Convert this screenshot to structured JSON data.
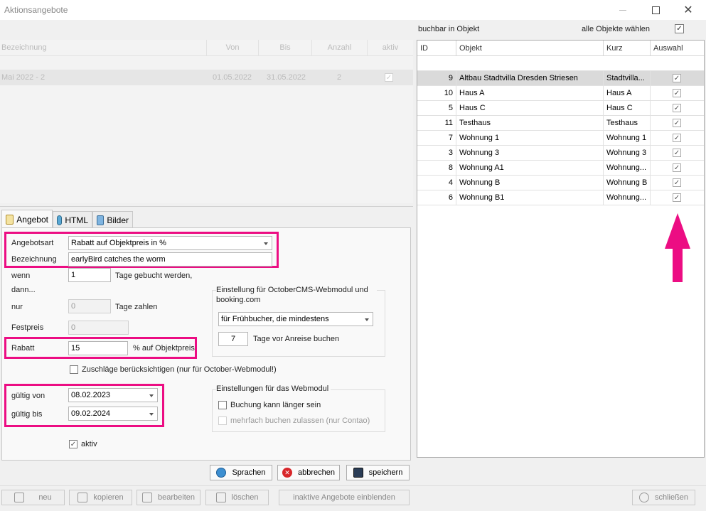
{
  "window": {
    "title": "Aktionsangebote"
  },
  "left_grid": {
    "headers": [
      "Bezeichnung",
      "Von",
      "Bis",
      "Anzahl",
      "aktiv"
    ],
    "row": {
      "bezeichnung": "Mai 2022 - 2",
      "von": "01.05.2022",
      "bis": "31.05.2022",
      "anzahl": "2",
      "aktiv": "✓"
    }
  },
  "tabs": [
    {
      "label": "Angebot",
      "icon": "angebot-icon"
    },
    {
      "label": "HTML",
      "icon": "html-icon"
    },
    {
      "label": "Bilder",
      "icon": "bilder-icon"
    }
  ],
  "form": {
    "angebotsart_label": "Angebotsart",
    "angebotsart_value": "Rabatt auf Objektpreis in %",
    "bezeichnung_label": "Bezeichnung",
    "bezeichnung_value": "earlyBird catches the worm",
    "wenn_label": "wenn",
    "wenn_value": "1",
    "wenn_suffix": "Tage gebucht werden,",
    "dann_label": "dann...",
    "nur_label": "nur",
    "nur_value": "0",
    "nur_suffix": "Tage zahlen",
    "festpreis_label": "Festpreis",
    "festpreis_value": "0",
    "rabatt_label": "Rabatt",
    "rabatt_value": "15",
    "rabatt_suffix": "% auf Objektpreis",
    "zuschlaege_label": "Zuschläge berücksichtigen (nur für October-Webmodul!)",
    "gueltig_von_label": "gültig von",
    "gueltig_von_value": "08.02.2023",
    "gueltig_bis_label": "gültig bis",
    "gueltig_bis_value": "09.02.2024",
    "aktiv_label": "aktiv",
    "aktiv_check": "✓"
  },
  "october_group": {
    "title": "Einstellung für OctoberCMS-Webmodul und booking.com",
    "select_value": "für Frühbucher, die mindestens",
    "days_value": "7",
    "days_suffix": "Tage vor Anreise buchen"
  },
  "webmodul_group": {
    "title": "Einstellungen für das Webmodul",
    "longer_label": "Buchung kann länger sein",
    "multi_label": "mehrfach buchen zulassen (nur Contao)"
  },
  "action_buttons": {
    "sprachen": "Sprachen",
    "abbrechen": "abbrechen",
    "speichern": "speichern"
  },
  "bottom_buttons": {
    "neu": "neu",
    "kopieren": "kopieren",
    "bearbeiten": "bearbeiten",
    "loeschen": "löschen",
    "inaktive": "inaktive Angebote einblenden",
    "schliessen": "schließen"
  },
  "right": {
    "buchbar_label": "buchbar in Objekt",
    "alle_label": "alle Objekte wählen",
    "alle_check": "✓",
    "headers": [
      "ID",
      "Objekt",
      "Kurz",
      "Auswahl"
    ],
    "rows": [
      {
        "id": "9",
        "objekt": "Altbau Stadtvilla Dresden Striesen",
        "kurz": "Stadtvilla...",
        "check": "✓"
      },
      {
        "id": "10",
        "objekt": "Haus A",
        "kurz": "Haus A",
        "check": "✓"
      },
      {
        "id": "5",
        "objekt": "Haus C",
        "kurz": "Haus C",
        "check": "✓"
      },
      {
        "id": "11",
        "objekt": "Testhaus",
        "kurz": "Testhaus",
        "check": "✓"
      },
      {
        "id": "7",
        "objekt": "Wohnung 1",
        "kurz": "Wohnung 1",
        "check": "✓"
      },
      {
        "id": "3",
        "objekt": "Wohnung 3",
        "kurz": "Wohnung 3",
        "check": "✓"
      },
      {
        "id": "8",
        "objekt": "Wohnung A1",
        "kurz": "Wohnung...",
        "check": "✓"
      },
      {
        "id": "4",
        "objekt": "Wohnung B",
        "kurz": "Wohnung B",
        "check": "✓"
      },
      {
        "id": "6",
        "objekt": "Wohnung B1",
        "kurz": "Wohnung...",
        "check": "✓"
      }
    ]
  },
  "colors": {
    "highlight": "#ec0d83"
  }
}
